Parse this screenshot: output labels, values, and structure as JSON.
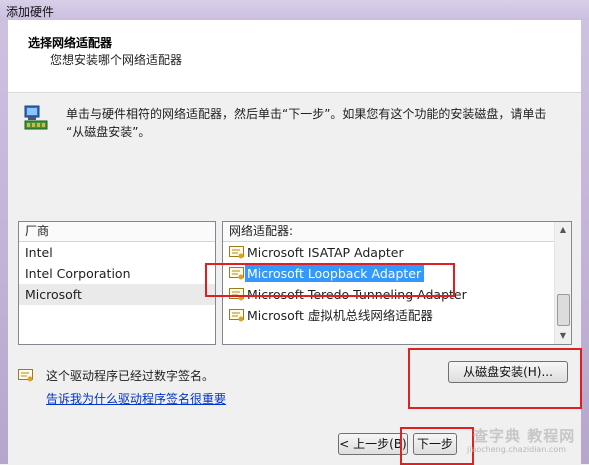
{
  "window": {
    "title": "添加硬件"
  },
  "header": {
    "title": "选择网络适配器",
    "subtitle": "您想安装哪个网络适配器"
  },
  "info": {
    "line1": "单击与硬件相符的网络适配器，然后单击“下一步”。如果您有这个功能的安装磁盘，请单击",
    "line2": "“从磁盘安装”。"
  },
  "manufacturer_list": {
    "header": "厂商",
    "items": [
      "Intel",
      "Intel Corporation",
      "Microsoft"
    ],
    "selected": "Microsoft"
  },
  "adapter_list": {
    "header": "网络适配器:",
    "items": [
      "Microsoft ISATAP Adapter",
      "Microsoft Loopback Adapter",
      "Microsoft Teredo Tunneling Adapter",
      "Microsoft 虚拟机总线网络适配器"
    ],
    "selected": "Microsoft Loopback Adapter"
  },
  "signed_text": "这个驱动程序已经过数字签名。",
  "why_link": "告诉我为什么驱动程序签名很重要",
  "buttons": {
    "have_disk": "从磁盘安装(H)...",
    "back": "< 上一步(B)",
    "next": "下一步"
  },
  "watermark": {
    "main": "查字典 教程网",
    "sub": "jiaocheng.chazidian.com"
  },
  "colors": {
    "selection": "#3399ff",
    "highlight_box": "#e02020",
    "link": "#0033cc"
  }
}
